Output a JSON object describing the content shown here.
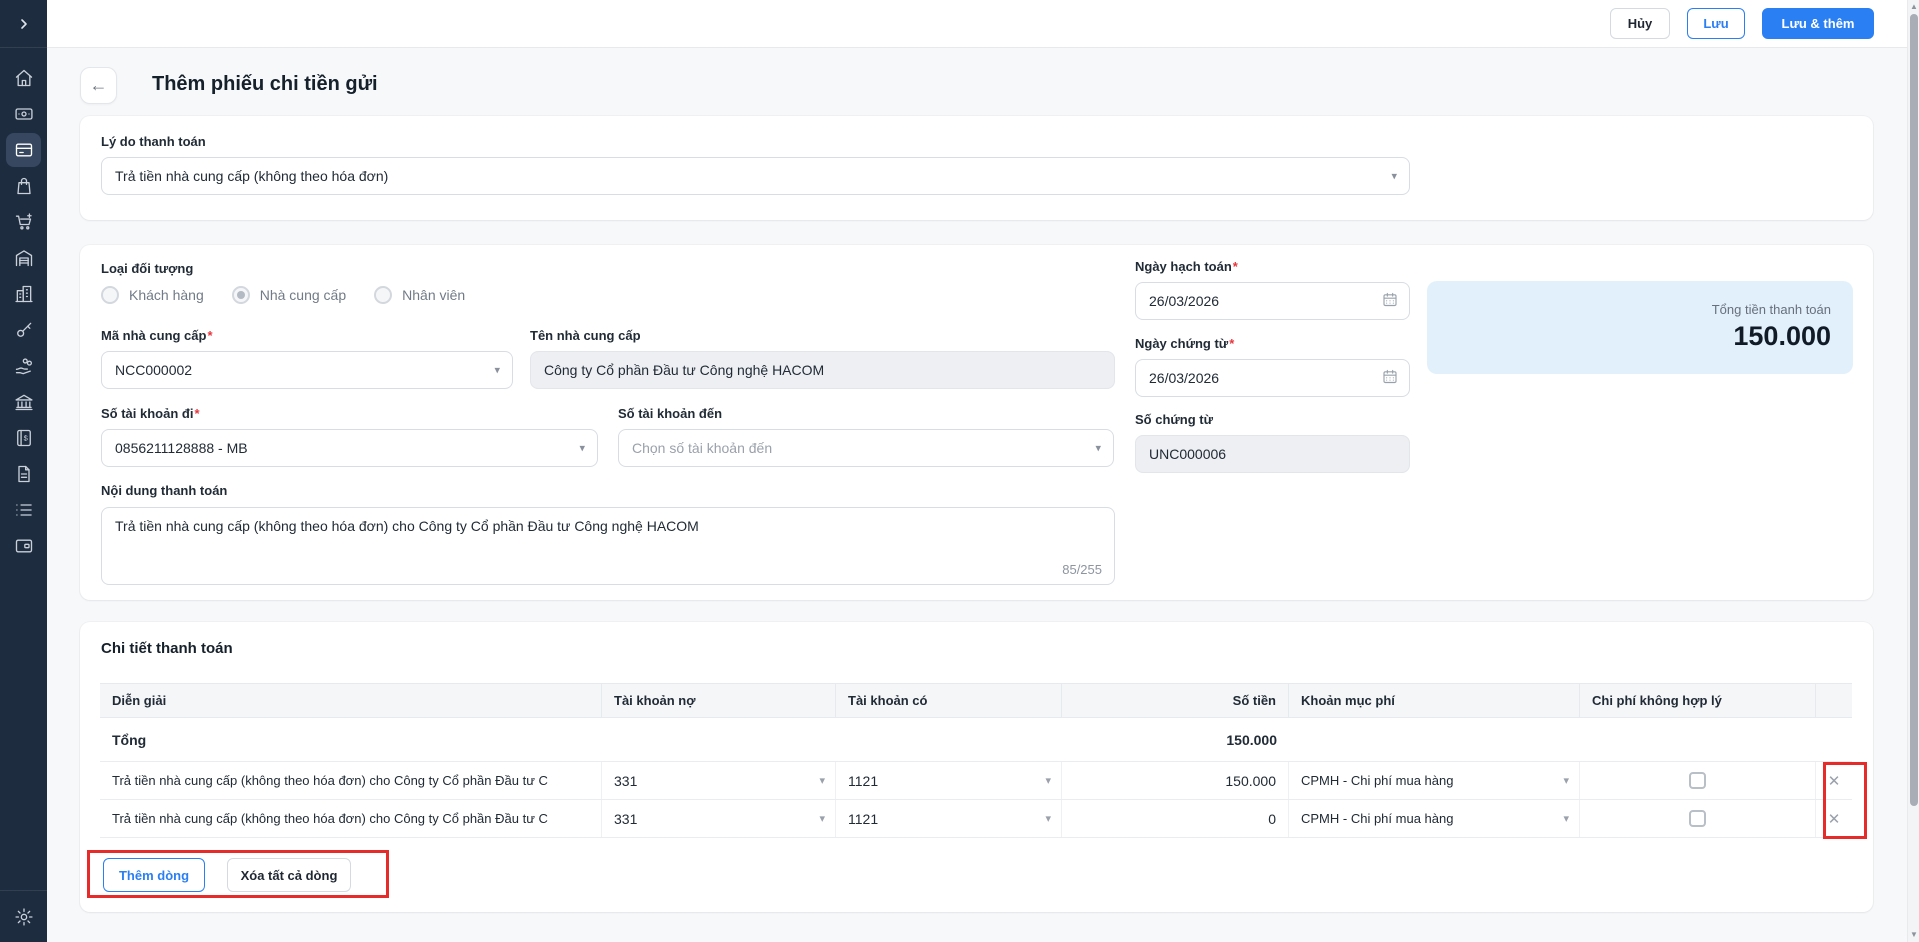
{
  "colors": {
    "accent": "#2a7ff3",
    "sidebar_bg": "#1d2c3f",
    "sidebar_active_bg": "#36475f",
    "summary_bg": "#e2f0fc",
    "annotation_red": "#e62b2b"
  },
  "topbar": {
    "cancel_label": "Hủy",
    "save_label": "Lưu",
    "save_and_add_label": "Lưu & thêm"
  },
  "page": {
    "title": "Thêm phiếu chi tiền gửi",
    "required_mark": "*"
  },
  "sidebar": {
    "collapse_icon": "chevron-right-icon",
    "icons": [
      "home",
      "money-bill",
      "credit-card",
      "shopping-bag",
      "shopping-cart",
      "warehouse",
      "organization",
      "key",
      "hand-coins",
      "bank",
      "cash-journal",
      "document",
      "bulleted-list",
      "wallet"
    ],
    "active_icon": "credit-card",
    "bottom_icon": "gear"
  },
  "reason": {
    "label": "Lý do thanh toán",
    "value": "Trả tiền nhà cung cấp (không theo hóa đơn)"
  },
  "form": {
    "object_type": {
      "label": "Loại đối tượng",
      "options": [
        {
          "label": "Khách hàng",
          "selected": false
        },
        {
          "label": "Nhà cung cấp",
          "selected": true
        },
        {
          "label": "Nhân viên",
          "selected": false
        }
      ]
    },
    "supplier_code": {
      "label": "Mã nhà cung cấp",
      "value": "NCC000002"
    },
    "supplier_name": {
      "label": "Tên nhà cung cấp",
      "value": "Công ty Cổ phần Đầu tư Công nghệ HACOM"
    },
    "account_from": {
      "label": "Số tài khoản đi",
      "value": "0856211128888 - MB"
    },
    "account_to": {
      "label": "Số tài khoản đến",
      "placeholder": "Chọn số tài khoản đến"
    },
    "posting_date": {
      "label": "Ngày hạch toán",
      "value": "26/03/2026"
    },
    "document_date": {
      "label": "Ngày chứng từ",
      "value": "26/03/2026"
    },
    "document_no": {
      "label": "Số chứng từ",
      "value": "UNC000006"
    },
    "payment_content": {
      "label": "Nội dung thanh toán",
      "value": "Trả tiền nhà cung cấp (không theo hóa đơn) cho Công ty Cổ phần Đầu tư Công nghệ HACOM",
      "counter": "85/255"
    }
  },
  "summary": {
    "label": "Tổng tiền thanh toán",
    "amount": "150.000"
  },
  "details": {
    "title": "Chi tiết thanh toán",
    "columns": [
      "Diễn giải",
      "Tài khoản nợ",
      "Tài khoản có",
      "Số tiền",
      "Khoản mục phí",
      "Chi phí không hợp lý"
    ],
    "total_label": "Tổng",
    "total_amount": "150.000",
    "rows": [
      {
        "description": "Trả tiền nhà cung cấp (không theo hóa đơn) cho Công ty Cổ phần Đầu tư C",
        "debit_account": "331",
        "credit_account": "1121",
        "amount": "150.000",
        "expense_item": "CPMH - Chi phí mua hàng",
        "invalid_expense_checked": false
      },
      {
        "description": "Trả tiền nhà cung cấp (không theo hóa đơn) cho Công ty Cổ phần Đầu tư C",
        "debit_account": "331",
        "credit_account": "1121",
        "amount": "0",
        "expense_item": "CPMH - Chi phí mua hàng",
        "invalid_expense_checked": false
      }
    ],
    "add_row_label": "Thêm dòng",
    "delete_all_label": "Xóa tất cả dòng"
  }
}
